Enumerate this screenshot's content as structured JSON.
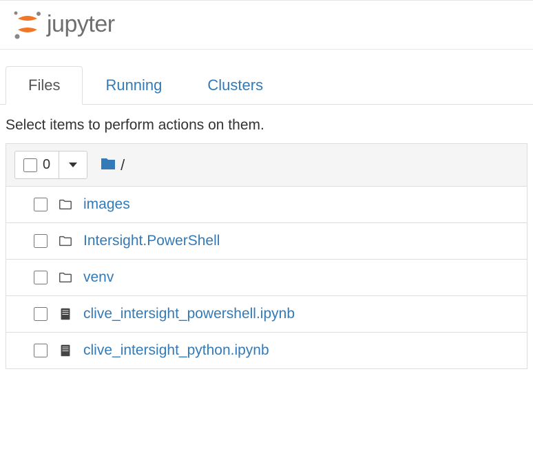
{
  "header": {
    "logo_text": "jupyter"
  },
  "tabs": [
    {
      "label": "Files",
      "active": true
    },
    {
      "label": "Running",
      "active": false
    },
    {
      "label": "Clusters",
      "active": false
    }
  ],
  "instruction": "Select items to perform actions on them.",
  "toolbar": {
    "selected_count": "0",
    "breadcrumb_sep": "/"
  },
  "files": [
    {
      "type": "folder",
      "name": "images"
    },
    {
      "type": "folder",
      "name": "Intersight.PowerShell"
    },
    {
      "type": "folder",
      "name": "venv"
    },
    {
      "type": "notebook",
      "name": "clive_intersight_powershell.ipynb"
    },
    {
      "type": "notebook",
      "name": "clive_intersight_python.ipynb"
    }
  ]
}
